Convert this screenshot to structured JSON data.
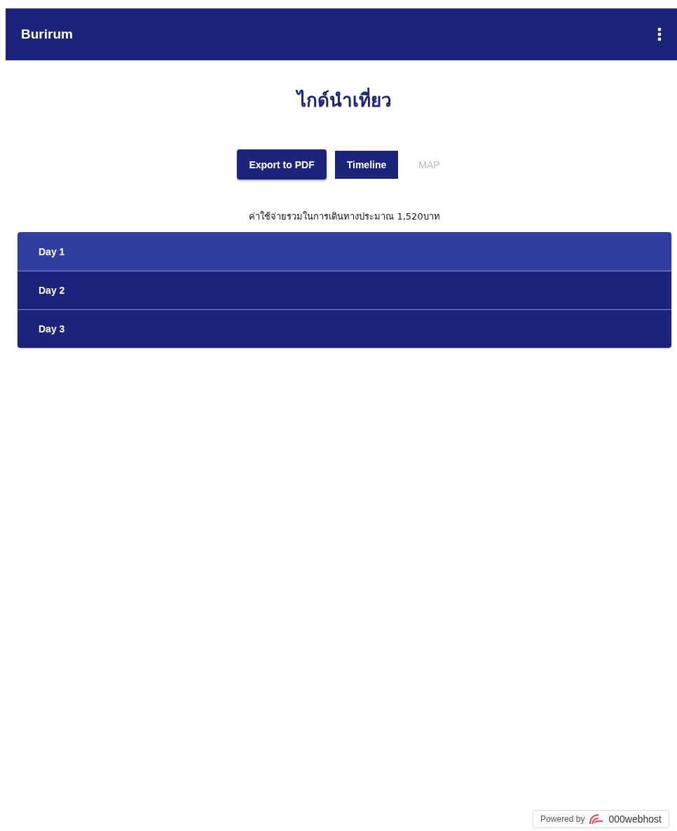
{
  "app_bar": {
    "title": "Burirum"
  },
  "page_title": "ไกด์นำเที่ยว",
  "actions": [
    {
      "kind": "raised",
      "label": "Export to PDF"
    },
    {
      "kind": "flat",
      "label": "Timeline"
    },
    {
      "kind": "text",
      "label": "MAP"
    }
  ],
  "summary": "ค่าใช้จ่ายรวมในการเดินทางประมาณ 1,520บาท",
  "days": [
    {
      "label": "Day 1",
      "selected": true
    },
    {
      "label": "Day 2",
      "selected": false
    },
    {
      "label": "Day 3",
      "selected": false
    }
  ],
  "footer_badge": {
    "prefix": "Powered by",
    "brand": "000webhost"
  }
}
